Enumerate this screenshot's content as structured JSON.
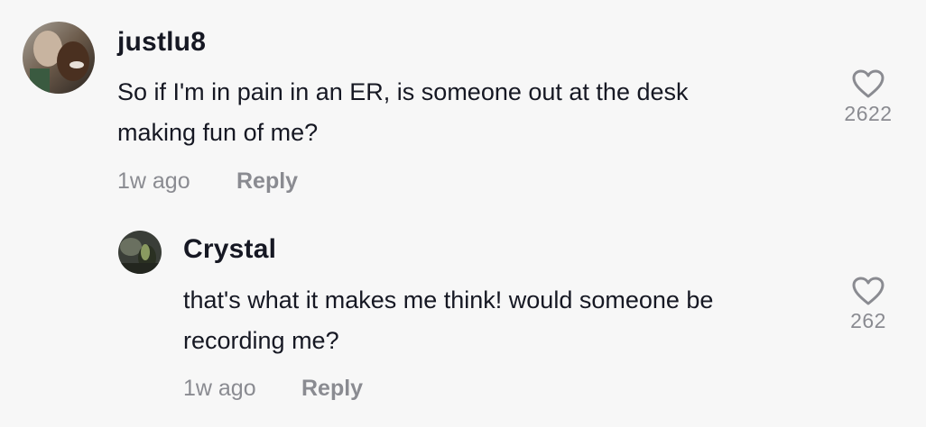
{
  "comments": [
    {
      "username": "justlu8",
      "text_line1": "So if I'm in pain in an ER, is someone out at the desk",
      "text_line2": "making fun of me?",
      "time": "1w ago",
      "reply_label": "Reply",
      "likes": "2622",
      "avatar_icon": "user-avatar-icon",
      "like_icon": "heart-outline-icon"
    },
    {
      "username": "Crystal",
      "text_line1": "that's what it makes me think! would someone be",
      "text_line2": "recording me?",
      "time": "1w ago",
      "reply_label": "Reply",
      "likes": "262",
      "avatar_icon": "user-avatar-icon",
      "like_icon": "heart-outline-icon"
    }
  ],
  "colors": {
    "background": "#f7f7f7",
    "text_primary": "#161823",
    "text_secondary": "#8a8b91"
  }
}
